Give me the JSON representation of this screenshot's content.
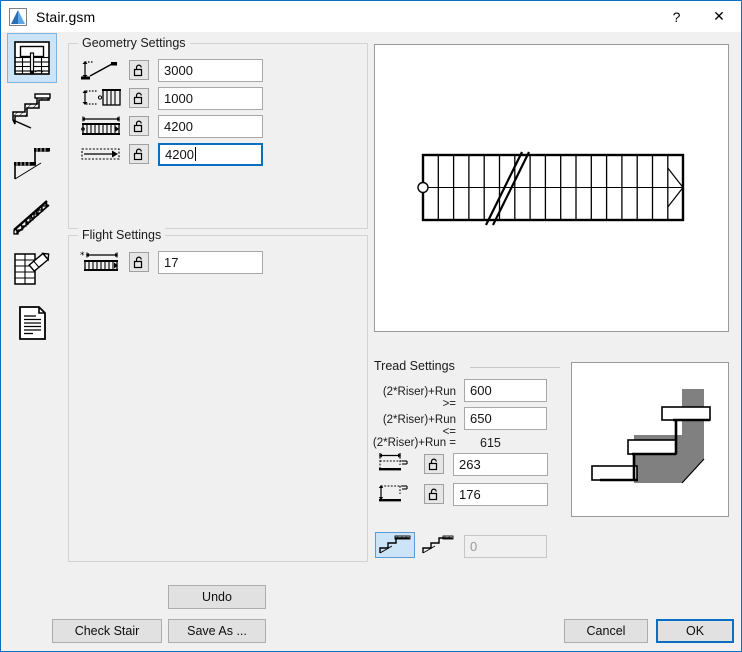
{
  "window": {
    "title": "Stair.gsm",
    "title_icon": "archicad-object-icon",
    "help_button": "?",
    "close_button": "✕",
    "accent_color": "#0a6fc2",
    "background_color": "#f0f0f0",
    "selection_color": "#cce4f7"
  },
  "sidebar": {
    "items": [
      {
        "name": "stair-plan-page",
        "icon": "stair-plan-u-shape-icon",
        "selected": true
      },
      {
        "name": "stair-structure-page",
        "icon": "stair-section-hatched-icon",
        "selected": false
      },
      {
        "name": "stair-finish-page",
        "icon": "stair-tread-finish-icon",
        "selected": false
      },
      {
        "name": "stair-railing-page",
        "icon": "stair-railing-3d-icon",
        "selected": false
      },
      {
        "name": "stair-annotation-page",
        "icon": "stair-plan-pencil-icon",
        "selected": false
      },
      {
        "name": "stair-listing-page",
        "icon": "document-lines-icon",
        "selected": false
      }
    ]
  },
  "geometry": {
    "legend": "Geometry Settings",
    "rows": [
      {
        "name": "stair-total-height",
        "icon": "stair-height-dimension-icon",
        "lock": "padlock-open-icon",
        "value": "3000",
        "focused": false
      },
      {
        "name": "railing-height",
        "icon": "railing-height-dimension-icon",
        "lock": "padlock-open-icon",
        "value": "1000",
        "focused": false
      },
      {
        "name": "stair-total-run",
        "icon": "stair-run-dimension-icon",
        "lock": "padlock-open-icon",
        "value": "4200",
        "focused": false
      },
      {
        "name": "stair-walking-line",
        "icon": "run-arrow-icon",
        "lock": "padlock-open-icon",
        "value": "4200",
        "focused": true
      }
    ]
  },
  "flight": {
    "legend": "Flight Settings",
    "rows": [
      {
        "name": "number-of-risers",
        "icon": "flight-riser-count-icon",
        "lock": "padlock-open-icon",
        "value": "17",
        "focused": false
      }
    ]
  },
  "tread": {
    "legend": "Tread Settings",
    "formula_rows": [
      {
        "name": "formula-min",
        "label": "(2*Riser)+Run >=",
        "value": "600",
        "readonly": false
      },
      {
        "name": "formula-max",
        "label": "(2*Riser)+Run <=",
        "value": "650",
        "readonly": false
      },
      {
        "name": "formula-actual",
        "label": "(2*Riser)+Run =",
        "value": "615",
        "readonly": true
      }
    ],
    "dimension_rows": [
      {
        "name": "tread-run",
        "icon": "tread-run-dimension-icon",
        "lock": "padlock-open-icon",
        "value": "263"
      },
      {
        "name": "riser-height",
        "icon": "riser-height-dimension-icon",
        "lock": "padlock-open-icon",
        "value": "176"
      }
    ],
    "nosing": {
      "options": [
        {
          "name": "nosing-flush-option",
          "icon": "stair-nosing-flush-icon",
          "selected": true
        },
        {
          "name": "nosing-overhang-option",
          "icon": "stair-nosing-overhang-icon",
          "selected": false
        }
      ],
      "value": "0",
      "disabled": true
    }
  },
  "previews": {
    "plan": {
      "name": "stair-plan-preview",
      "type": "plan-view",
      "treads": 17
    },
    "detail": {
      "name": "tread-detail-preview",
      "type": "section-detail"
    }
  },
  "buttons": {
    "undo": "Undo",
    "check_stair": "Check Stair",
    "save_as": "Save As ...",
    "cancel": "Cancel",
    "ok": "OK"
  }
}
